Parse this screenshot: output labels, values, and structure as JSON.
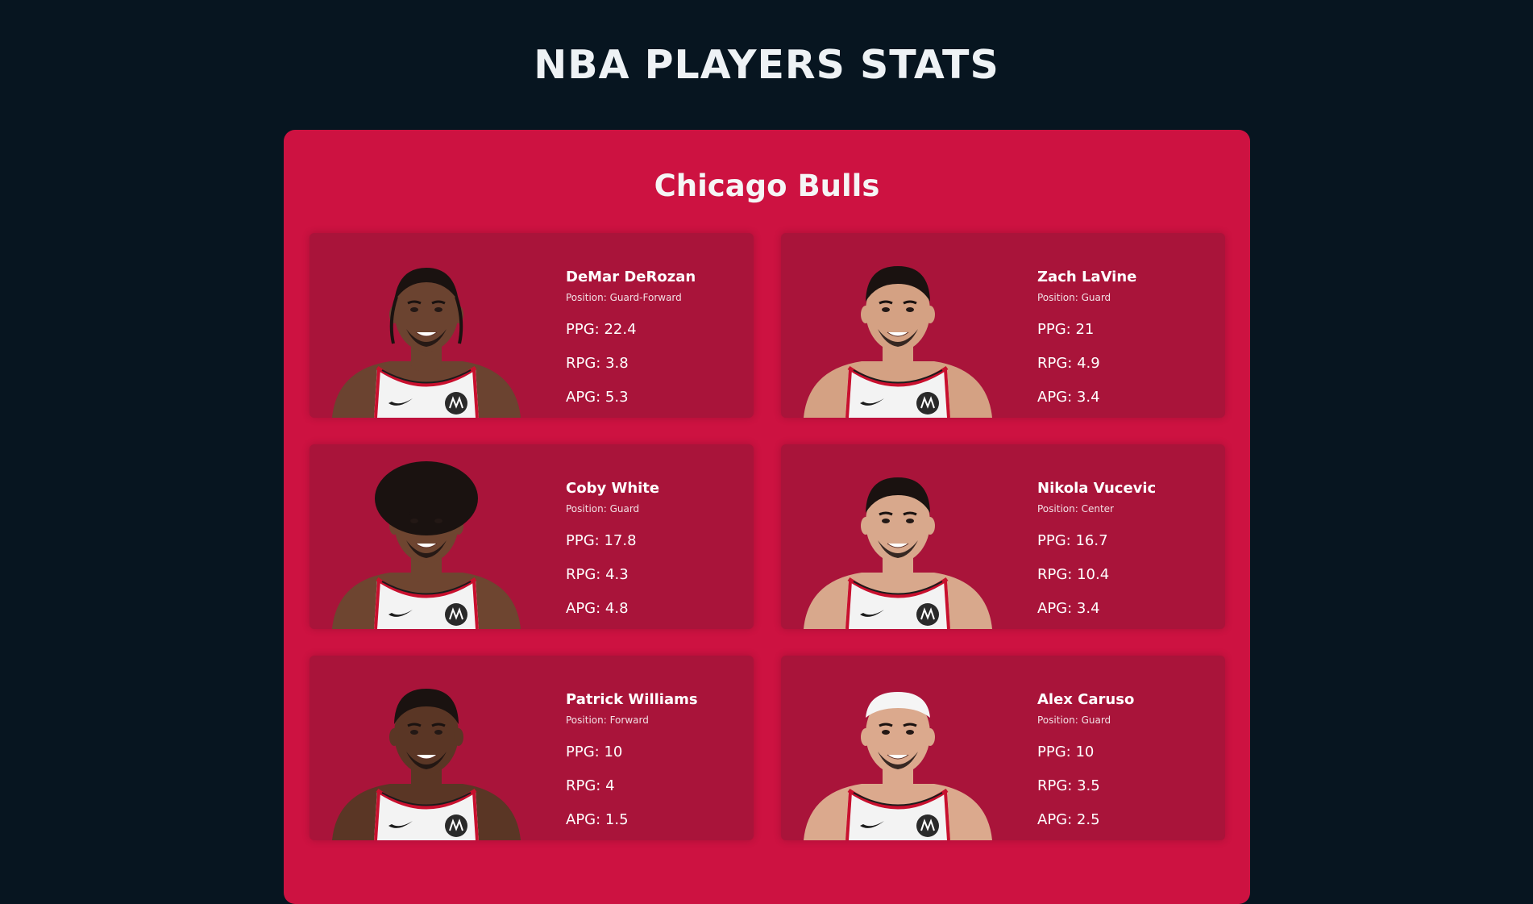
{
  "page": {
    "title": "NBA PLAYERS STATS"
  },
  "team": {
    "name": "Chicago Bulls",
    "accent": "#cd1241",
    "card_bg": "#a9143a"
  },
  "players": [
    {
      "name": "DeMar DeRozan",
      "position": "Position: Guard-Forward",
      "ppg": "PPG: 22.4",
      "rpg": "RPG: 3.8",
      "apg": "APG: 5.3",
      "skin": "#6b4330",
      "hair": "braids",
      "headgear": "none"
    },
    {
      "name": "Zach LaVine",
      "position": "Position: Guard",
      "ppg": "PPG: 21",
      "rpg": "RPG: 4.9",
      "apg": "APG: 3.4",
      "skin": "#d4a183",
      "hair": "short",
      "headgear": "none"
    },
    {
      "name": "Coby White",
      "position": "Position: Guard",
      "ppg": "PPG: 17.8",
      "rpg": "RPG: 4.3",
      "apg": "APG: 4.8",
      "skin": "#6e4530",
      "hair": "afro",
      "headgear": "none"
    },
    {
      "name": "Nikola Vucevic",
      "position": "Position: Center",
      "ppg": "PPG: 16.7",
      "rpg": "RPG: 10.4",
      "apg": "APG: 3.4",
      "skin": "#d8a88c",
      "hair": "short",
      "headgear": "none"
    },
    {
      "name": "Patrick Williams",
      "position": "Position: Forward",
      "ppg": "PPG: 10",
      "rpg": "RPG: 4",
      "apg": "APG: 1.5",
      "skin": "#5a3625",
      "hair": "twists",
      "headgear": "none"
    },
    {
      "name": "Alex Caruso",
      "position": "Position: Guard",
      "ppg": "PPG: 10",
      "rpg": "RPG: 3.5",
      "apg": "APG: 2.5",
      "skin": "#dba98d",
      "hair": "none",
      "headgear": "headband"
    }
  ]
}
